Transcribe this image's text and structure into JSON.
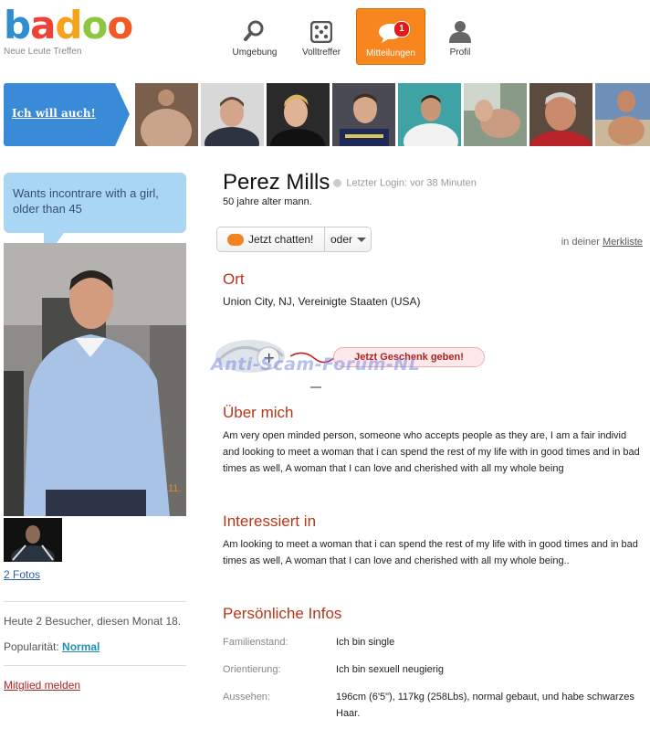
{
  "logo": {
    "b": "b",
    "a": "a",
    "d": "d",
    "o1": "o",
    "o2": "o",
    "tagline": "Neue Leute Treffen"
  },
  "nav": {
    "items": [
      {
        "label": "Umgebung",
        "icon": "search-icon"
      },
      {
        "label": "Volltreffer",
        "icon": "dice-icon"
      },
      {
        "label": "Mitteilungen",
        "icon": "chat-icon",
        "badge": "1",
        "active": true
      },
      {
        "label": "Profil",
        "icon": "user-icon"
      }
    ]
  },
  "strip": {
    "cta_label": "Ich will auch!"
  },
  "left": {
    "bubble_text": "Wants incontrare with a girl, older than 45",
    "photo_counter": "11.",
    "fotos_link": "2 Fotos",
    "visitors": "Heute 2 Besucher, diesen Monat 18.",
    "popularity_label": "Popularität:",
    "popularity_value": "Normal",
    "report_link": "Mitglied melden"
  },
  "profile": {
    "name": "Perez Mills",
    "last_login": "Letzter Login: vor 38 Minuten",
    "age_line": "50 jahre alter mann.",
    "chat_button": "Jetzt chatten!",
    "oder_button": "oder",
    "merkliste_prefix": "in deiner",
    "merkliste_link": "Merkliste",
    "ort_heading": "Ort",
    "ort_value": "Union City, NJ, Vereinigte Staaten (USA)",
    "gift_button": "Jetzt Geschenk geben!",
    "watermark": "Anti-Scam-Forum-NL",
    "about_heading": "Über mich",
    "about_text": "Am very open minded person, someone who accepts people as they are, I am a fair individ and looking to meet a woman that i can spend the rest of my life with in good times and in bad times as well, A woman that I can love and cherished with all my whole being",
    "interest_heading": "Interessiert in",
    "interest_text": "Am looking to meet a woman that i can spend the rest of my life with in good times and in bad times as well, A woman that I can love and cherished with all my whole being..",
    "personal_heading": "Persönliche Infos",
    "personal_infos": [
      {
        "label": "Familienstand:",
        "value": "Ich bin single"
      },
      {
        "label": "Orientierung:",
        "value": "Ich bin sexuell neugierig"
      },
      {
        "label": "Aussehen:",
        "value": "196cm (6'5\"), 117kg (258Lbs), normal gebaut, und habe schwarzes Haar."
      }
    ]
  },
  "colors": {
    "nav_active": "#f7861f",
    "cta_blue": "#3a8bd7",
    "heading": "#b5361a",
    "bubble": "#a9d6f5"
  }
}
